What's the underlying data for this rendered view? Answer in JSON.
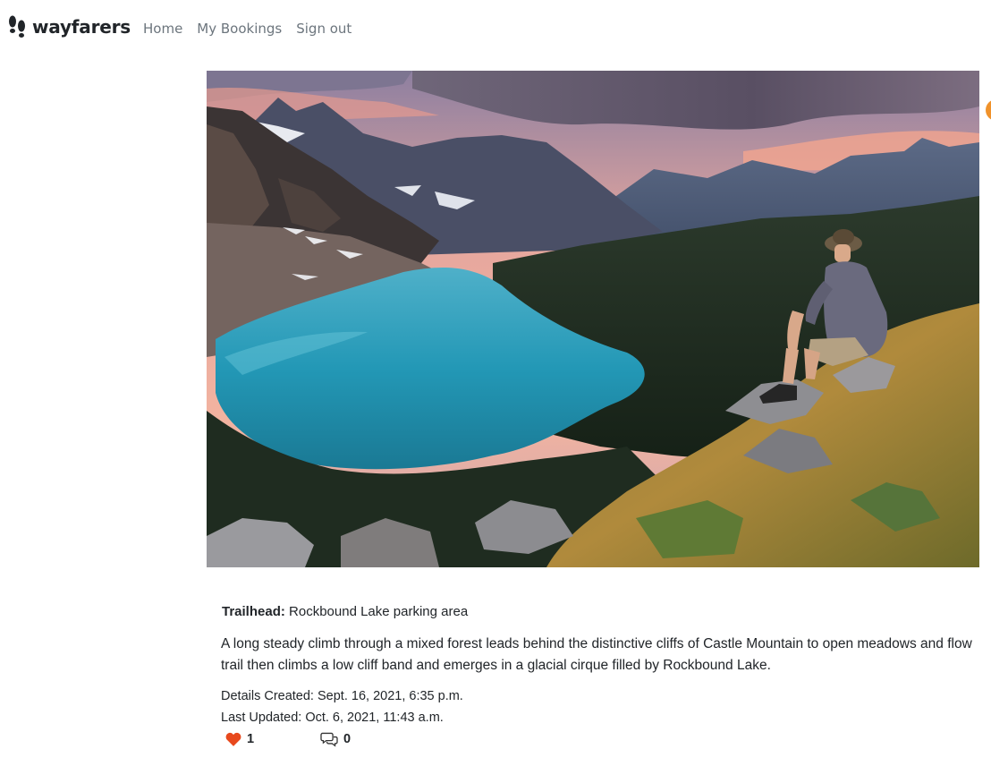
{
  "nav": {
    "brand": "wayfarers",
    "brand_icon": "footprints-icon",
    "links": [
      "Home",
      "My Bookings",
      "Sign out"
    ]
  },
  "hero": {
    "alt": "Hiker overlooking Rockbound Lake"
  },
  "trail": {
    "trailhead_label": "Trailhead:",
    "trailhead_value": "Rockbound Lake parking area",
    "description_line1": "A long steady climb through a mixed forest leads behind the distinctive cliffs of Castle Mountain to open meadows and flow",
    "description_line2": "trail then climbs a low cliff band and emerges in a glacial cirque filled by Rockbound Lake.",
    "created": "Details Created: Sept. 16, 2021, 6:35 p.m.",
    "updated": "Last Updated: Oct. 6, 2021, 11:43 a.m.",
    "likes": "1",
    "comments": "0"
  },
  "colors": {
    "heart": "#e8491d",
    "nav_link": "#6c757d",
    "avatar": "#f0922b"
  }
}
